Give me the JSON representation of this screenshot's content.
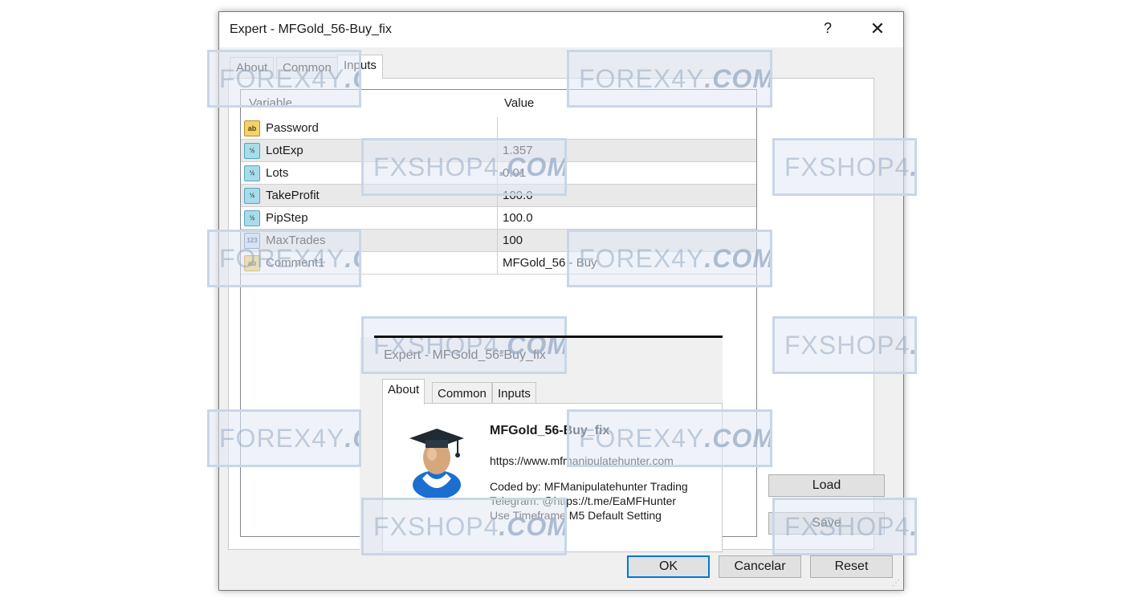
{
  "dialog": {
    "title": "Expert - MFGold_56-Buy_fix",
    "help_label": "?",
    "close_label": "✕",
    "tabs": [
      {
        "label": "About"
      },
      {
        "label": "Common"
      },
      {
        "label": "Inputs"
      }
    ],
    "active_tab": "Inputs"
  },
  "grid": {
    "headers": {
      "variable": "Variable",
      "value": "Value"
    },
    "rows": [
      {
        "type_icon": "text-type-icon",
        "type_label": "ab",
        "name": "Password",
        "value": ""
      },
      {
        "type_icon": "double-type-icon",
        "type_label": "½",
        "name": "LotExp",
        "value": "1.357"
      },
      {
        "type_icon": "double-type-icon",
        "type_label": "½",
        "name": "Lots",
        "value": "0.01"
      },
      {
        "type_icon": "double-type-icon",
        "type_label": "½",
        "name": "TakeProfit",
        "value": "100.0"
      },
      {
        "type_icon": "double-type-icon",
        "type_label": "½",
        "name": "PipStep",
        "value": "100.0"
      },
      {
        "type_icon": "integer-type-icon",
        "type_label": "123",
        "name": "MaxTrades",
        "value": "100"
      },
      {
        "type_icon": "text-type-icon",
        "type_label": "ab",
        "name": "Comment1",
        "value": "MFGold_56 - Buy"
      }
    ]
  },
  "buttons": {
    "load": "Load",
    "save": "Save",
    "ok": "OK",
    "cancel": "Cancelar",
    "reset": "Reset"
  },
  "about_preview": {
    "title": "Expert - MFGold_56-Buy_fix",
    "tabs": [
      {
        "label": "About"
      },
      {
        "label": "Common"
      },
      {
        "label": "Inputs"
      }
    ],
    "active_tab": "About",
    "ea_name": "MFGold_56-Buy_fix",
    "url": "https://www.mfmanipulatehunter.com",
    "lines": [
      "Coded by: MFManipulatehunter Trading",
      "Telegram: @https://t.me/EaMFHunter",
      "Use Timeframe M5 Default Setting"
    ]
  },
  "watermarks": {
    "forex": [
      "FOREX4Y",
      ".COM"
    ],
    "fxshop": [
      "FXSHOP4",
      ".COM"
    ]
  },
  "colors": {
    "accent": "#0078d7",
    "row_alt": "#e9e9e9",
    "watermark": "#c9d6e6"
  }
}
